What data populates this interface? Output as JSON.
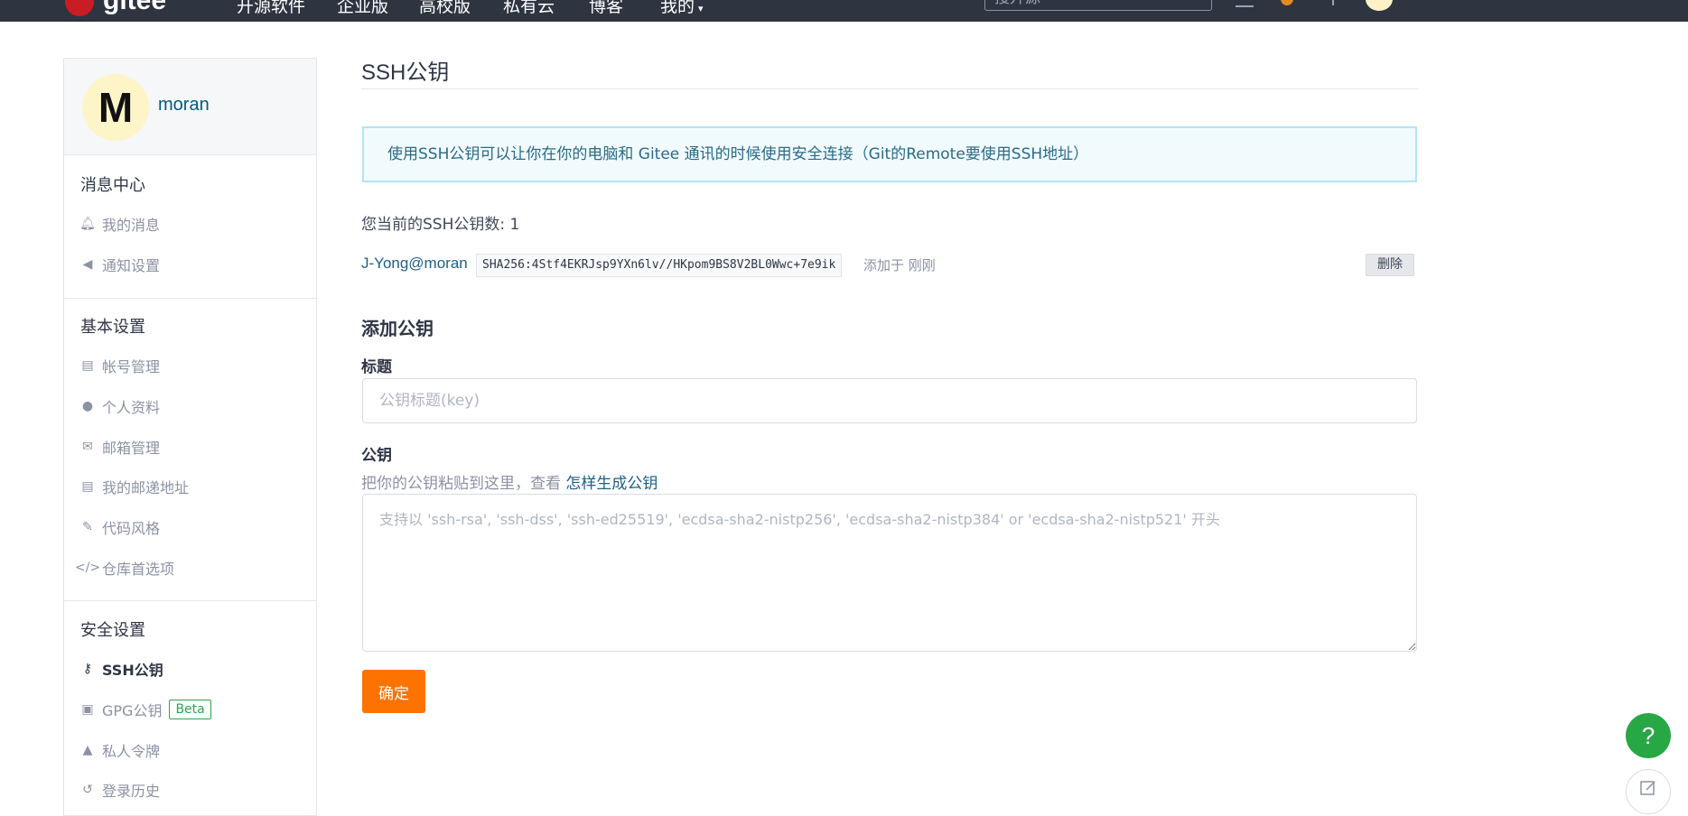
{
  "topnav": {
    "logo_text": "gitee",
    "items": [
      "开源软件",
      "企业版",
      "高校版",
      "私有云",
      "博客",
      "我的"
    ],
    "search_placeholder": "搜开源"
  },
  "sidebar": {
    "username": "moran",
    "avatar_letter": "M",
    "groups": [
      {
        "title": "消息中心",
        "items": [
          {
            "label": "我的消息",
            "icon": "bell-icon"
          },
          {
            "label": "通知设置",
            "icon": "volume-icon"
          }
        ]
      },
      {
        "title": "基本设置",
        "items": [
          {
            "label": "帐号管理",
            "icon": "id-card-icon"
          },
          {
            "label": "个人资料",
            "icon": "user-icon"
          },
          {
            "label": "邮箱管理",
            "icon": "envelope-icon"
          },
          {
            "label": "我的邮递地址",
            "icon": "address-card-icon"
          },
          {
            "label": "代码风格",
            "icon": "brush-icon"
          },
          {
            "label": "仓库首选项",
            "icon": "code-icon"
          }
        ]
      },
      {
        "title": "安全设置",
        "items": [
          {
            "label": "SSH公钥",
            "icon": "key-icon"
          },
          {
            "label": "GPG公钥",
            "icon": "lock-icon",
            "badge": "Beta"
          },
          {
            "label": "私人令牌",
            "icon": "user-secret-icon"
          },
          {
            "label": "登录历史",
            "icon": "history-icon"
          }
        ]
      }
    ]
  },
  "main": {
    "title": "SSH公钥",
    "info": "使用SSH公钥可以让你在你的电脑和 Gitee 通讯的时候使用安全连接（Git的Remote要使用SSH地址）",
    "key_count_text": "您当前的SSH公钥数: 1",
    "key": {
      "owner": "J-Yong@moran",
      "fingerprint": "SHA256:4Stf4EKRJsp9YXn6lv//HKpom9BS8V2BL0Wwc+7e9ik",
      "added": "添加于 刚刚",
      "delete_label": "删除"
    },
    "add_section_title": "添加公钥",
    "title_label": "标题",
    "title_placeholder": "公钥标题(key)",
    "key_label": "公钥",
    "key_help": "把你的公钥粘贴到这里，查看",
    "key_help_link": "怎样生成公钥",
    "key_placeholder": "支持以 'ssh-rsa', 'ssh-dss', 'ssh-ed25519', 'ecdsa-sha2-nistp256', 'ecdsa-sha2-nistp384' or 'ecdsa-sha2-nistp521' 开头",
    "confirm_label": "确定"
  },
  "floating": {
    "help_label": "?"
  },
  "colors": {
    "accent": "#fe7300",
    "topbar": "#2e3440",
    "link": "#1f5f86",
    "help": "#28a745"
  }
}
